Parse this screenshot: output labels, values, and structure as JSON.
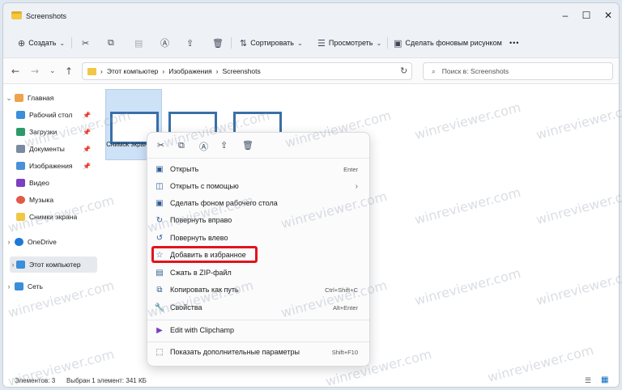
{
  "window": {
    "title": "Screenshots",
    "minimize": "–",
    "maximize": "☐",
    "close": "✕"
  },
  "toolbar": {
    "create_label": "Создать",
    "sort_label": "Сортировать",
    "view_label": "Просмотреть",
    "wallpaper_label": "Сделать фоновым рисунком",
    "more_label": "•••"
  },
  "address": {
    "crumb1": "Этот компьютер",
    "crumb2": "Изображения",
    "crumb3": "Screenshots",
    "search_placeholder": "Поиск в: Screenshots"
  },
  "sidebar": {
    "items": [
      {
        "label": "Главная"
      },
      {
        "label": "Рабочий стол"
      },
      {
        "label": "Загрузки"
      },
      {
        "label": "Документы"
      },
      {
        "label": "Изображения"
      },
      {
        "label": "Видео"
      },
      {
        "label": "Музыка"
      },
      {
        "label": "Снимки экрана"
      },
      {
        "label": "OneDrive"
      },
      {
        "label": "Этот компьютер"
      },
      {
        "label": "Сеть"
      }
    ]
  },
  "files": [
    {
      "label": "Снимок экрана (1)"
    }
  ],
  "context_menu": {
    "items": [
      {
        "label": "Открыть",
        "shortcut": "Enter"
      },
      {
        "label": "Открыть с помощью",
        "shortcut": ""
      },
      {
        "label": "Сделать фоном рабочего стола",
        "shortcut": ""
      },
      {
        "label": "Повернуть вправо",
        "shortcut": ""
      },
      {
        "label": "Повернуть влево",
        "shortcut": ""
      },
      {
        "label": "Добавить в избранное",
        "shortcut": ""
      },
      {
        "label": "Сжать в ZIP-файл",
        "shortcut": ""
      },
      {
        "label": "Копировать как путь",
        "shortcut": "Ctrl+Shift+C"
      },
      {
        "label": "Свойства",
        "shortcut": "Alt+Enter"
      },
      {
        "label": "Edit with Clipchamp",
        "shortcut": ""
      },
      {
        "label": "Показать дополнительные параметры",
        "shortcut": "Shift+F10"
      }
    ]
  },
  "status": {
    "items_count": "Элементов: 3",
    "selected": "Выбран 1 элемент: 341 КБ"
  },
  "watermark": "winreviewer.com",
  "colors": {
    "accent": "#0067c0",
    "highlight_box": "#e0141e",
    "folder": "#f2c744"
  }
}
